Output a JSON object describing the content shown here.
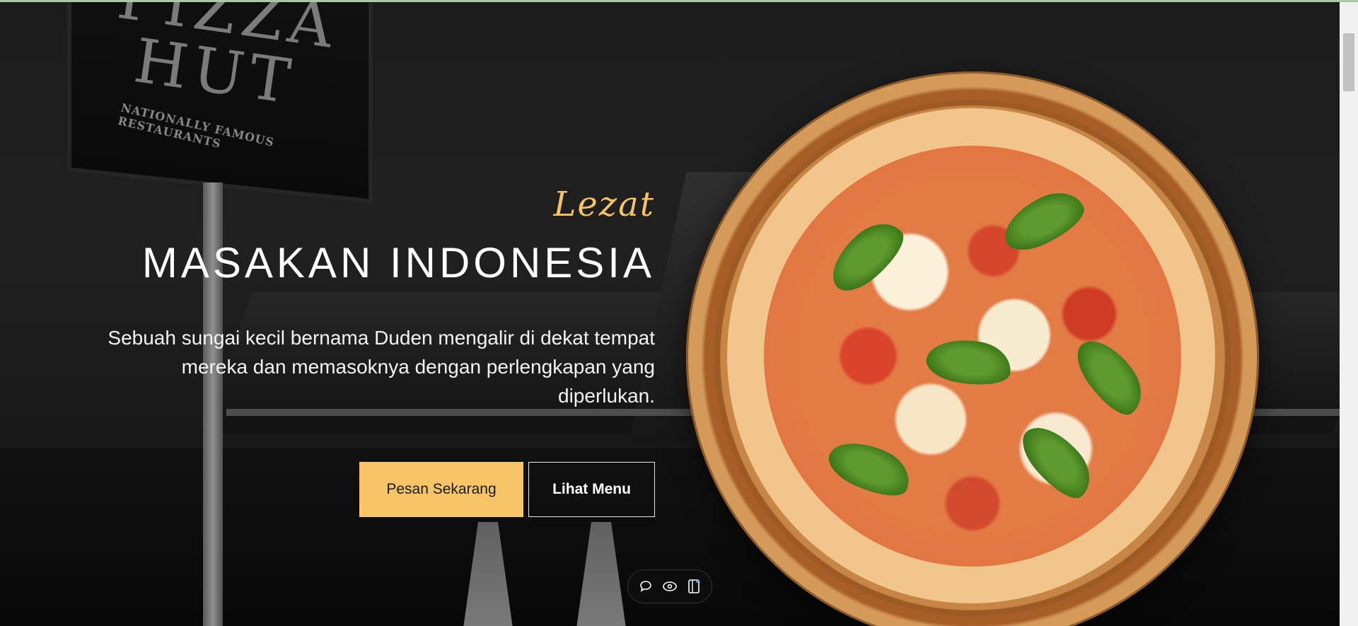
{
  "hero": {
    "background_sign_text": "PIZZA HUT",
    "background_sign_subtext": "NATIONALLY FAMOUS RESTAURANTS",
    "eyebrow": "Lezat",
    "title": "MASAKAN INDONESIA",
    "description": "Sebuah sungai kecil bernama Duden mengalir di dekat tempat mereka dan memasoknya dengan perlengkapan yang diperlukan.",
    "buttons": {
      "primary_label": "Pesan Sekarang",
      "secondary_label": "Lihat Menu"
    },
    "image": "pizza-on-wooden-board"
  },
  "toolbar": {
    "icons": [
      "comment-icon",
      "eye-icon",
      "mobile-device-icon"
    ]
  },
  "colors": {
    "accent": "#f7c466",
    "text_primary": "#ffffff",
    "toolbar_bg": "#0d0d0d"
  }
}
